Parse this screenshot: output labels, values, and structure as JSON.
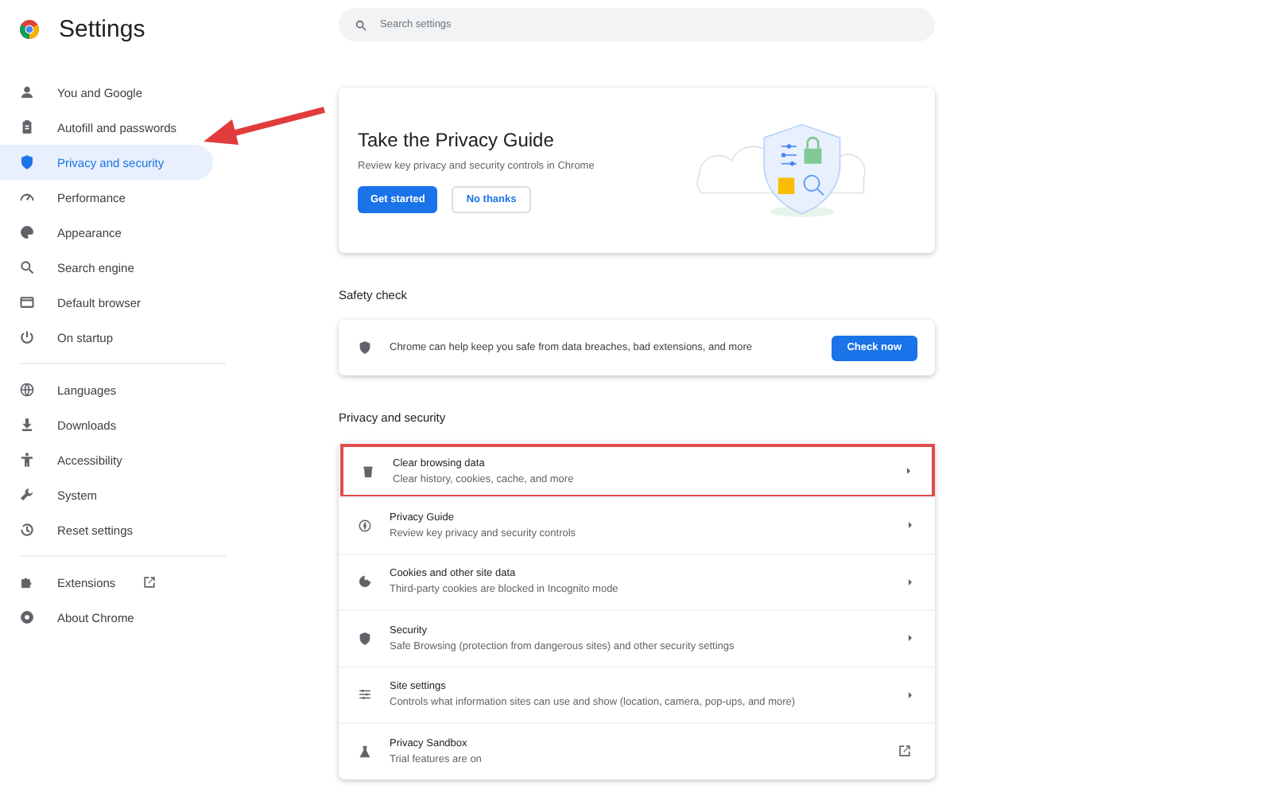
{
  "header": {
    "title": "Settings"
  },
  "search": {
    "placeholder": "Search settings"
  },
  "sidebar": {
    "groups": [
      {
        "items": [
          {
            "label": "You and Google",
            "selected": false
          },
          {
            "label": "Autofill and passwords",
            "selected": false
          },
          {
            "label": "Privacy and security",
            "selected": true
          },
          {
            "label": "Performance",
            "selected": false
          },
          {
            "label": "Appearance",
            "selected": false
          },
          {
            "label": "Search engine",
            "selected": false
          },
          {
            "label": "Default browser",
            "selected": false
          },
          {
            "label": "On startup",
            "selected": false
          }
        ]
      },
      {
        "items": [
          {
            "label": "Languages",
            "selected": false
          },
          {
            "label": "Downloads",
            "selected": false
          },
          {
            "label": "Accessibility",
            "selected": false
          },
          {
            "label": "System",
            "selected": false
          },
          {
            "label": "Reset settings",
            "selected": false
          }
        ]
      },
      {
        "items": [
          {
            "label": "Extensions",
            "selected": false,
            "external": true
          },
          {
            "label": "About Chrome",
            "selected": false
          }
        ]
      }
    ]
  },
  "privacy_guide_card": {
    "title": "Take the Privacy Guide",
    "description": "Review key privacy and security controls in Chrome",
    "buttons": [
      {
        "label": "Get started",
        "kind": "primary"
      },
      {
        "label": "No thanks",
        "kind": "secondary"
      }
    ]
  },
  "safety_check": {
    "heading": "Safety check",
    "text": "Chrome can help keep you safe from data breaches, bad extensions, and more",
    "button": "Check now"
  },
  "privacy_section": {
    "heading": "Privacy and security",
    "rows": [
      {
        "title": "Clear browsing data",
        "subtitle": "Clear history, cookies, cache, and more",
        "external": false,
        "highlighted": true
      },
      {
        "title": "Privacy Guide",
        "subtitle": "Review key privacy and security controls",
        "external": false,
        "highlighted": false
      },
      {
        "title": "Cookies and other site data",
        "subtitle": "Third-party cookies are blocked in Incognito mode",
        "external": false,
        "highlighted": false
      },
      {
        "title": "Security",
        "subtitle": "Safe Browsing (protection from dangerous sites) and other security settings",
        "external": false,
        "highlighted": false
      },
      {
        "title": "Site settings",
        "subtitle": "Controls what information sites can use and show (location, camera, pop-ups, and more)",
        "external": false,
        "highlighted": false
      },
      {
        "title": "Privacy Sandbox",
        "subtitle": "Trial features are on",
        "external": true,
        "highlighted": false
      }
    ]
  }
}
